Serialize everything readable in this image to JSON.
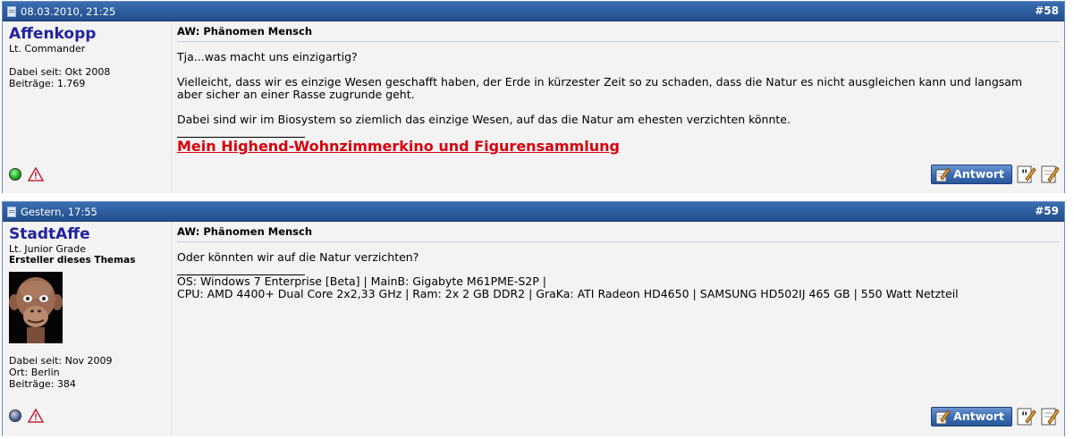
{
  "posts": [
    {
      "date": "08.03.2010, 21:25",
      "number": "#58",
      "username": "Affenkopp",
      "usertitle": "Lt. Commander",
      "subtitle": "",
      "joined": "Dabei seit: Okt 2008",
      "location": "",
      "posts_count": "Beiträge: 1.769",
      "online": true,
      "title": "AW: Phänomen Mensch",
      "paragraphs": [
        "Tja...was macht uns einzigartig?",
        "Vielleicht, dass wir es einzige Wesen geschafft haben, der Erde in kürzester Zeit so zu schaden, dass die Natur es nicht ausgleichen kann und langsam aber sicher an einer Rasse zugrunde geht.",
        "Dabei sind wir im Biosystem so ziemlich das einzige Wesen, auf das die Natur am ehesten verzichten könnte."
      ],
      "signature_link": "Mein Highend-Wohnzimmerkino und Figurensammlung",
      "reply_label": "Antwort"
    },
    {
      "date": "Gestern, 17:55",
      "number": "#59",
      "username": "StadtAffe",
      "usertitle": "Lt. Junior Grade",
      "subtitle": "Ersteller dieses Themas",
      "joined": "Dabei seit: Nov 2009",
      "location": "Ort: Berlin",
      "posts_count": "Beiträge: 384",
      "online": false,
      "title": "AW: Phänomen Mensch",
      "paragraphs": [
        "Oder könnten wir auf die Natur verzichten?"
      ],
      "signature_lines": [
        "OS: Windows 7 Enterprise [Beta] | MainB: Gigabyte M61PME-S2P |",
        "CPU: AMD 4400+ Dual Core 2x2,33 GHz | Ram: 2x 2 GB DDR2 | GraKa: ATI Radeon HD4650 | SAMSUNG HD502IJ 465 GB | 550 Watt Netzteil"
      ],
      "reply_label": "Antwort"
    }
  ],
  "colors": {
    "header_bg": "#2d5c9c",
    "username": "#22229c",
    "signature_link": "#d8000c",
    "online": "#1aa31a",
    "offline": "#4a5e8c"
  },
  "icons": {
    "post_icon": "document-icon",
    "status": "status-dot-icon",
    "report": "warning-triangle-icon",
    "quote": "quote-icon",
    "multiquote": "multiquote-icon"
  }
}
